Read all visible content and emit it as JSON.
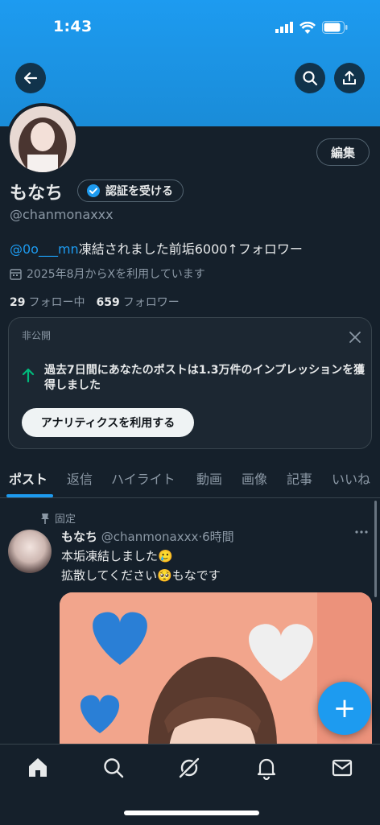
{
  "status_bar": {
    "time": "1:43"
  },
  "profile": {
    "name": "もなち",
    "verify_label": "認証を受ける",
    "handle": "@chanmonaxxx",
    "edit_label": "編集",
    "bio_mention": "@0o___mn",
    "bio_rest": "凍結されました前垢6000↑フォロワー",
    "joined": "2025年8月からXを利用しています",
    "following_count": "29",
    "following_label": "フォロー中",
    "followers_count": "659",
    "followers_label": "フォロワー"
  },
  "insight_card": {
    "private_label": "非公開",
    "text": "過去7日間にあなたのポストは1.3万件のインプレッションを獲得しました",
    "button_label": "アナリティクスを利用する"
  },
  "tabs": [
    "ポスト",
    "返信",
    "ハイライト",
    "動画",
    "画像",
    "記事",
    "いいね"
  ],
  "pinned_post": {
    "pinned_label": "固定",
    "author": "もなち",
    "meta": "@chanmonaxxx·6時間",
    "line1": "本垢凍結しました🥲",
    "line2": "拡散してください🥺もなです"
  },
  "fab_label": "+",
  "icons": [
    "back-arrow-icon",
    "search-icon",
    "share-icon",
    "verified-badge-icon",
    "calendar-icon",
    "close-icon",
    "arrow-up-icon",
    "pin-icon",
    "more-icon",
    "home-icon",
    "explore-icon",
    "grok-icon",
    "notifications-icon",
    "messages-icon"
  ]
}
